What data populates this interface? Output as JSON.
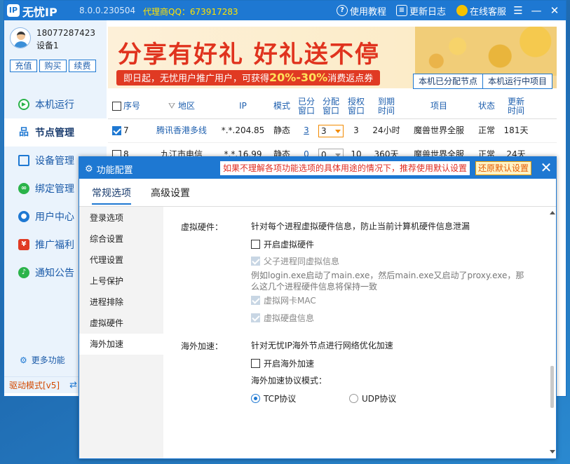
{
  "app": {
    "name": "无忧IP",
    "version": "8.0.0.230504",
    "agent": "代理商QQ：673917283"
  },
  "titlebar": {
    "tutorial": "使用教程",
    "changelog": "更新日志",
    "service": "在线客服"
  },
  "user": {
    "phone": "18077287423",
    "device": "设备1",
    "buttons": [
      "充值",
      "购买",
      "续费"
    ]
  },
  "nav": [
    {
      "label": "本机运行",
      "icon": "play-icon",
      "active": false
    },
    {
      "label": "节点管理",
      "icon": "network-icon",
      "active": true
    },
    {
      "label": "设备管理",
      "icon": "device-icon",
      "active": false
    },
    {
      "label": "绑定管理",
      "icon": "bind-icon",
      "active": false
    },
    {
      "label": "用户中心",
      "icon": "user-icon",
      "active": false
    },
    {
      "label": "推广福利",
      "icon": "gift-icon",
      "active": false
    },
    {
      "label": "通知公告",
      "icon": "bell-icon",
      "active": false
    }
  ],
  "more": "更多功能",
  "driver": "驱动模式[v5]",
  "banner": {
    "title": "分享有好礼 好礼送不停",
    "sub_pre": "即日起，无忧用户推广用户，可获得",
    "sub_pct": "20%-30%",
    "sub_post": "消费返点券"
  },
  "node_tabs": [
    "本机已分配节点",
    "本机运行中项目"
  ],
  "table": {
    "headers": [
      "序号",
      "地区",
      "IP",
      "模式",
      "已分\n窗口",
      "分配\n窗口",
      "授权\n窗口",
      "到期\n时间",
      "项目",
      "状态",
      "更新\n时间"
    ],
    "rows": [
      {
        "checked": true,
        "no": "7",
        "region": "腾讯香港多线",
        "ip": "*.*.204.85",
        "mode": "静态",
        "assigned": "3",
        "alloc": "3",
        "auth": "3",
        "expire": "24小时",
        "project": "魔兽世界全服",
        "status": "正常",
        "updated": "181天"
      },
      {
        "checked": false,
        "no": "8",
        "region": "九江市电信",
        "ip": "*.*.16.99",
        "mode": "静态",
        "assigned": "0",
        "alloc": "0",
        "auth": "10",
        "expire": "360天",
        "project": "魔兽世界全服",
        "status": "正常",
        "updated": "24天"
      }
    ]
  },
  "dialog": {
    "title": "功能配置",
    "warning": "如果不理解各项功能选项的具体用途的情况下，推荐使用默认设置",
    "reset": "还原默认设置",
    "tabs": [
      "常规选项",
      "高级设置"
    ],
    "left_items": [
      "登录选项",
      "综合设置",
      "代理设置",
      "上号保护",
      "进程排除",
      "虚拟硬件",
      "海外加速"
    ],
    "vhw": {
      "label": "虚拟硬件：",
      "desc": "针对每个进程虚拟硬件信息，防止当前计算机硬件信息泄漏",
      "enable": "开启虚拟硬件",
      "parent_child": "父子进程同虚拟信息",
      "note": "例如login.exe启动了main.exe，然后main.exe又启动了proxy.exe，那么这几个进程硬件信息将保持一致",
      "mac": "虚拟网卡MAC",
      "disk": "虚拟硬盘信息"
    },
    "overseas": {
      "label": "海外加速：",
      "desc": "针对无忧IP海外节点进行网络优化加速",
      "enable": "开启海外加速",
      "protocol_label": "海外加速协议模式：",
      "tcp": "TCP协议",
      "udp": "UDP协议",
      "selected": "TCP协议"
    }
  },
  "colors": {
    "brand": "#1e78d2",
    "warning": "#e02a1e",
    "agent": "#ffe400"
  }
}
